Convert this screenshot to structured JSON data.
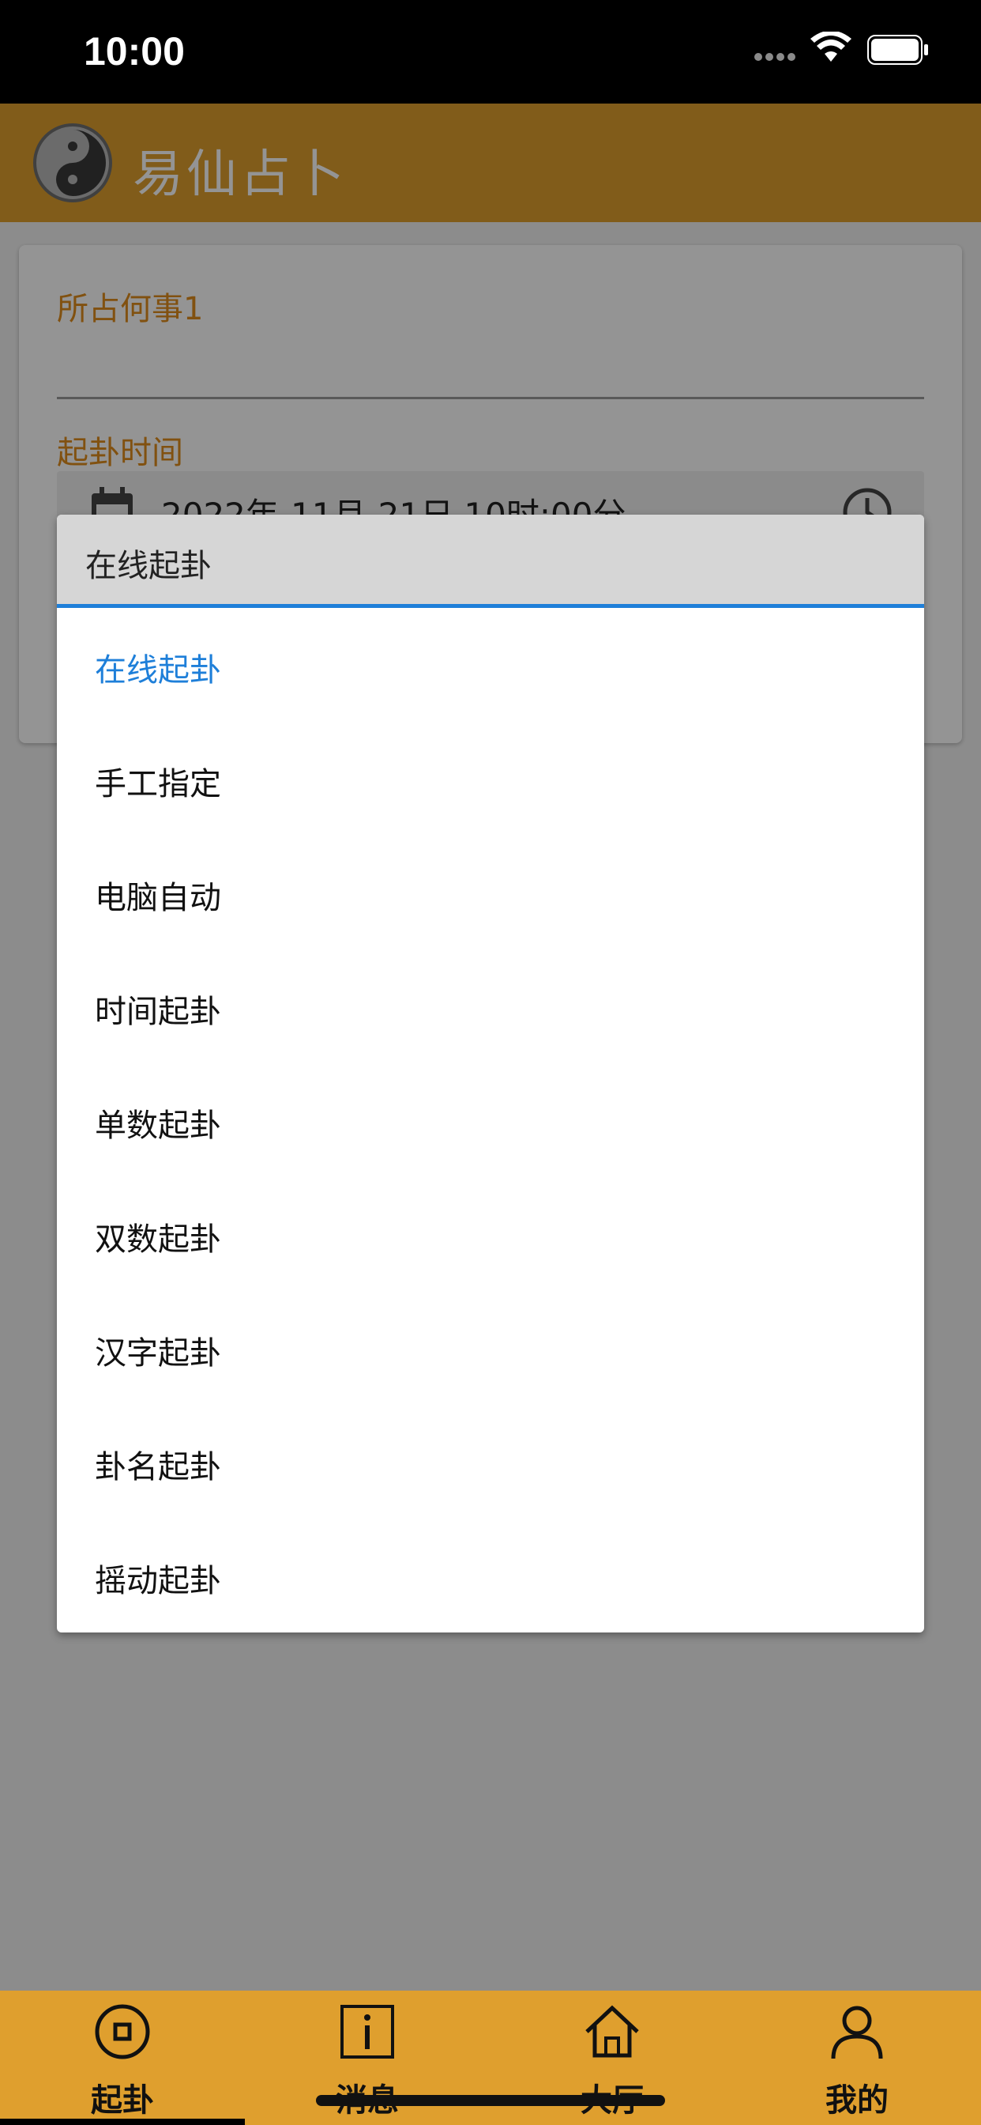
{
  "status_bar": {
    "time": "10:00"
  },
  "header": {
    "title": "易仙占卜",
    "logo_icon": "yin-yang-logo-icon"
  },
  "form": {
    "question_label": "所占何事1",
    "time_label": "起卦时间",
    "datetime_value": "2022年-11月-21日 10时:00分"
  },
  "dropdown": {
    "current_value": "在线起卦",
    "options": [
      {
        "label": "在线起卦",
        "selected": true
      },
      {
        "label": "手工指定"
      },
      {
        "label": "电脑自动"
      },
      {
        "label": "时间起卦"
      },
      {
        "label": "单数起卦"
      },
      {
        "label": "双数起卦"
      },
      {
        "label": "汉字起卦"
      },
      {
        "label": "卦名起卦"
      },
      {
        "label": "摇动起卦"
      }
    ]
  },
  "bottom_nav": {
    "items": [
      {
        "label": "起卦",
        "icon": "circle-square-icon",
        "active": true
      },
      {
        "label": "消息",
        "icon": "info-icon"
      },
      {
        "label": "大厅",
        "icon": "home-icon"
      },
      {
        "label": "我的",
        "icon": "user-icon"
      }
    ]
  },
  "colors": {
    "brand": "#df9f2e",
    "label_orange": "#df8c1c",
    "accent_blue": "#1e7fd9"
  }
}
